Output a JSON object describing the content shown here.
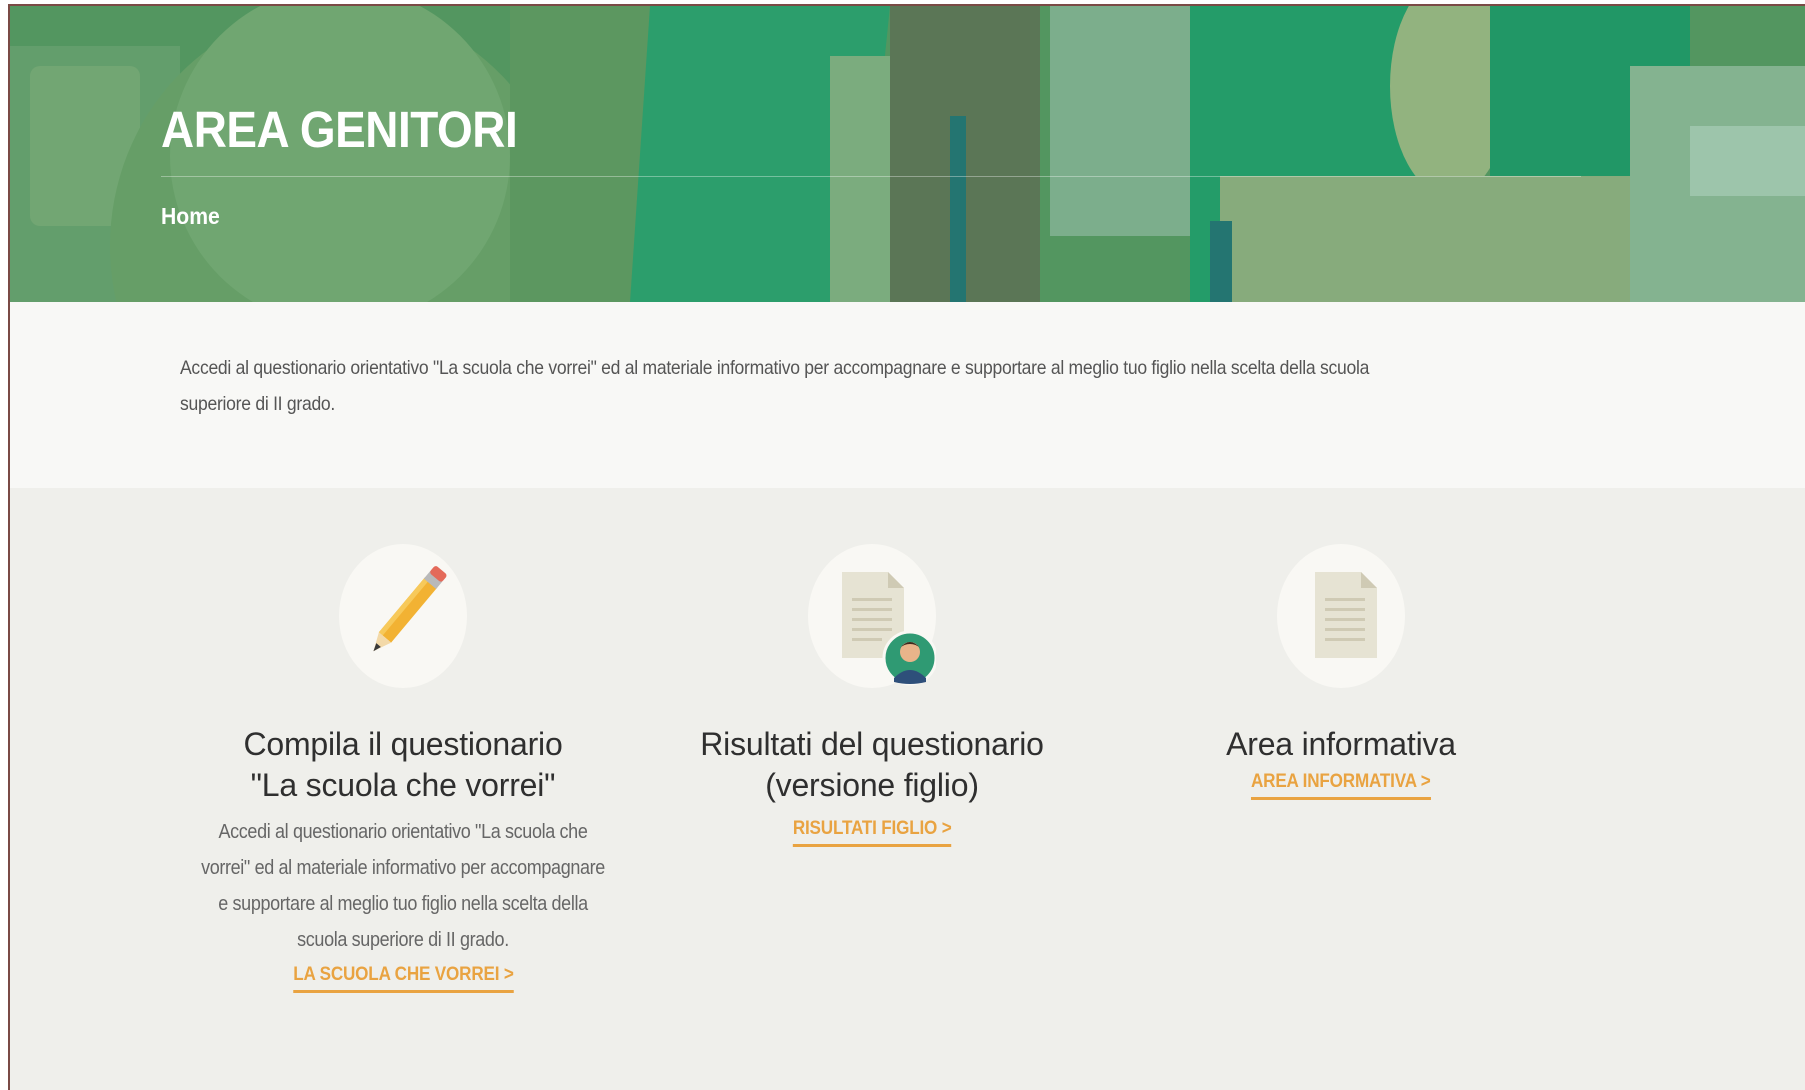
{
  "hero": {
    "title": "AREA GENITORI",
    "breadcrumb": "Home"
  },
  "intro": {
    "text": "Accedi al questionario orientativo \"La scuola che vorrei\" ed al materiale informativo per accompagnare e supportare al meglio tuo figlio nella scelta della scuola superiore di II grado."
  },
  "cards": [
    {
      "icon": "pencil-icon",
      "title_line1": "Compila il questionario",
      "title_line2": "\"La scuola che vorrei\"",
      "description": "Accedi al questionario orientativo \"La scuola che vorrei\" ed al materiale informativo per accompagnare e supportare al meglio tuo figlio nella scelta della scuola superiore di II grado.",
      "link": "LA SCUOLA CHE VORREI >"
    },
    {
      "icon": "document-user-icon",
      "title_line1": "Risultati del questionario",
      "title_line2": "(versione figlio)",
      "link": "RISULTATI FIGLIO >"
    },
    {
      "icon": "document-icon",
      "title_line1": "Area informativa",
      "link": "AREA INFORMATIVA >"
    }
  ],
  "colors": {
    "accent": "#e9a341",
    "hero_overlay": "#0c8c5a",
    "intro_bg": "#f8f8f6",
    "cards_bg": "#efefeb"
  }
}
